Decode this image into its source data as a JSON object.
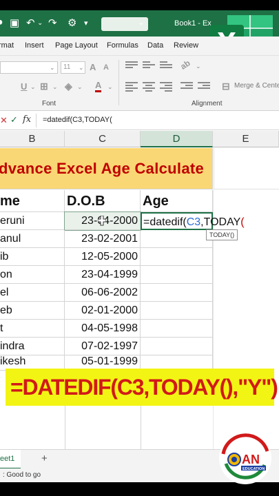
{
  "titlebar": {
    "book_title": "Book1 - Ex",
    "dropdown": "⌄"
  },
  "ribbon": {
    "tabs": [
      "rmat",
      "Insert",
      "Page Layout",
      "Formulas",
      "Data",
      "Review"
    ],
    "font_size": "11",
    "groups": [
      "Font",
      "Alignment"
    ],
    "merge_label": "Merge & Cente"
  },
  "formula_bar": {
    "formula": "=datedif(C3,TODAY("
  },
  "columns": [
    "B",
    "C",
    "D",
    "E"
  ],
  "sheet": {
    "title": "dvance Excel Age Calculate",
    "headers": {
      "name": "me",
      "dob": "D.O.B",
      "age": "Age"
    },
    "rows": [
      {
        "name": "eruni",
        "dob": "23-04-2000"
      },
      {
        "name": "anul",
        "dob": "23-02-2001"
      },
      {
        "name": "ib",
        "dob": "12-05-2000"
      },
      {
        "name": "on",
        "dob": "23-04-1999"
      },
      {
        "name": "el",
        "dob": "06-06-2002"
      },
      {
        "name": "eb",
        "dob": "02-01-2000"
      },
      {
        "name": "t",
        "dob": "04-05-1998"
      },
      {
        "name": "indra",
        "dob": "07-02-1997"
      },
      {
        "name": "ikesh",
        "dob": "05-01-1999"
      }
    ],
    "edit": {
      "prefix": "=datedif(",
      "ref": "C3",
      "mid": ",TODAY",
      "paren": "("
    },
    "tooltip": "TODAY()"
  },
  "banner": {
    "text": "=DATEDIF(C3,TODAY(),\"Y\")"
  },
  "sheet_tab": "eet1",
  "add_sheet": "+",
  "status": ": Good to go",
  "logo": {
    "letters": "AN",
    "tagline": "EDUCATION"
  },
  "colors": {
    "excel_green": "#1e7145",
    "title_fill": "#f9d774",
    "title_text": "#c00000",
    "banner_fill": "#f2f513",
    "banner_text": "#d11a1a"
  }
}
